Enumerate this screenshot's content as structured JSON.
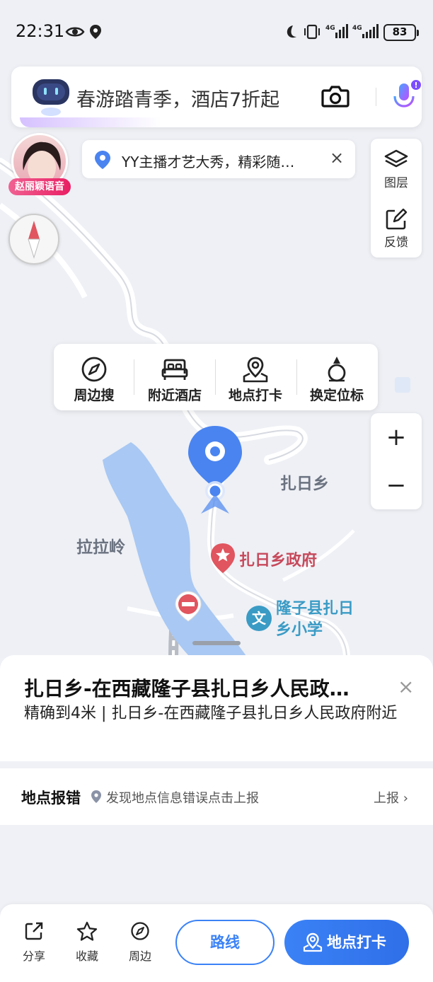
{
  "status_bar": {
    "time": "22:31",
    "battery": "83",
    "network_1": "4G",
    "network_2": "4G"
  },
  "search": {
    "placeholder": "春游踏青季，酒店7折起"
  },
  "avatar": {
    "label": "赵丽颖语音"
  },
  "notice": {
    "text": "YY主播才艺大秀，精彩随…",
    "close": "×"
  },
  "layer_panel": {
    "layers_label": "图层",
    "feedback_label": "反馈"
  },
  "action_menu": {
    "items": [
      {
        "label": "周边搜",
        "icon": "compass-icon"
      },
      {
        "label": "附近酒店",
        "icon": "bed-icon"
      },
      {
        "label": "地点打卡",
        "icon": "map-pin-icon"
      },
      {
        "label": "换定位标",
        "icon": "location-marker-icon"
      }
    ]
  },
  "zoom": {
    "in": "+",
    "out": "−"
  },
  "map_labels": {
    "zari_township": "扎日乡",
    "lalaling": "拉拉岭",
    "gov": "扎日乡政府",
    "school_line1": "隆子县扎日",
    "school_line2": "乡小学",
    "school_icon": "文"
  },
  "sheet": {
    "title": "扎日乡-在西藏隆子县扎日乡人民政…",
    "description": "精确到4米 | 扎日乡-在西藏隆子县扎日乡人民政府附近",
    "close": "×"
  },
  "report": {
    "title": "地点报错",
    "hint": "发现地点信息错误点击上报",
    "action": "上报 ›"
  },
  "bottom_bar": {
    "share": "分享",
    "favorite": "收藏",
    "nearby": "周边",
    "route": "路线",
    "checkin": "地点打卡"
  },
  "colors": {
    "accent": "#3b82f6",
    "water": "#a9c8f3",
    "poi_red": "#e0555f",
    "poi_blue": "#3a9bc5"
  }
}
